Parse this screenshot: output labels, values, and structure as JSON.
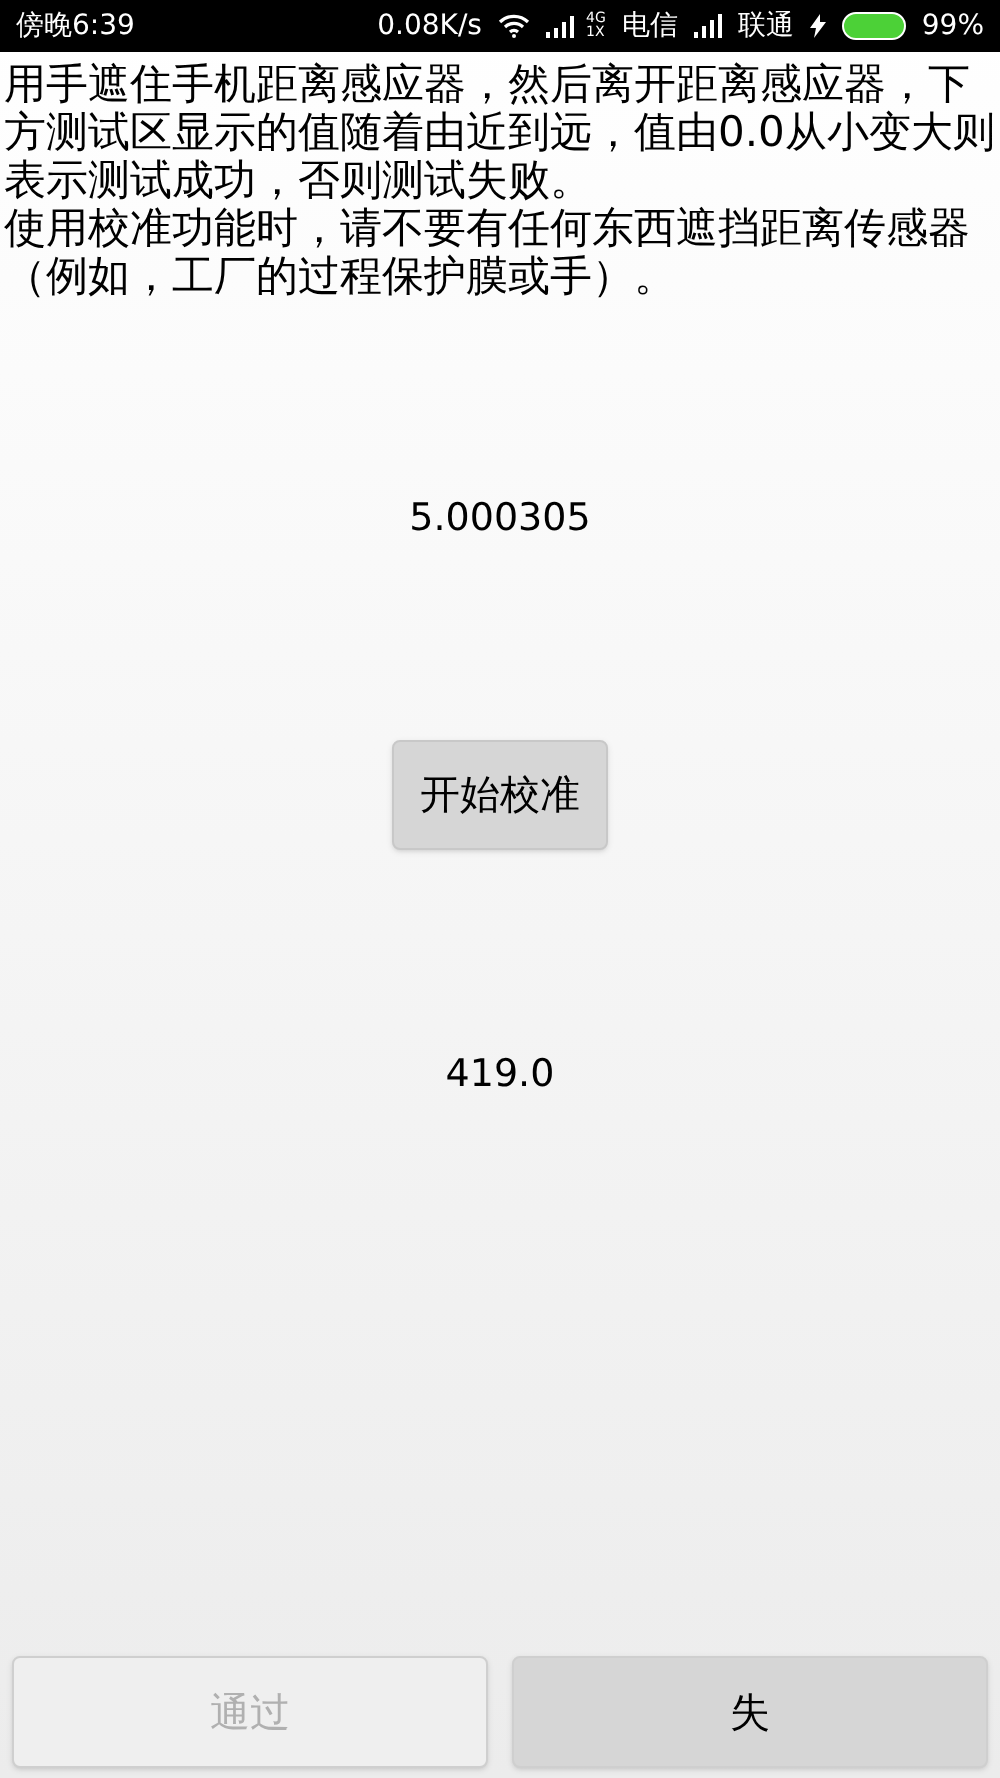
{
  "status_bar": {
    "time": "傍晚6:39",
    "speed": "0.08K/s",
    "network_4g": "4G",
    "network_1x": "1X",
    "carrier_1": "电信",
    "carrier_2": "联通",
    "battery": "99%"
  },
  "instructions": [
    "用手遮住手机距离感应器，然后离开距离感应器，下方测试区显示的值随着由近到远，值由0.0从小变大则表示测试成功，否则测试失败。",
    "使用校准功能时，请不要有任何东西遮挡距离传感器（例如，工厂的过程保护膜或手）。"
  ],
  "sensor_value": "5.000305",
  "calibrate_button": {
    "label": "开始校准",
    "disabled": false
  },
  "calibration_value": "419.0",
  "buttons": [
    {
      "label": "通过",
      "disabled": true
    },
    {
      "label": "失",
      "disabled": false
    }
  ]
}
